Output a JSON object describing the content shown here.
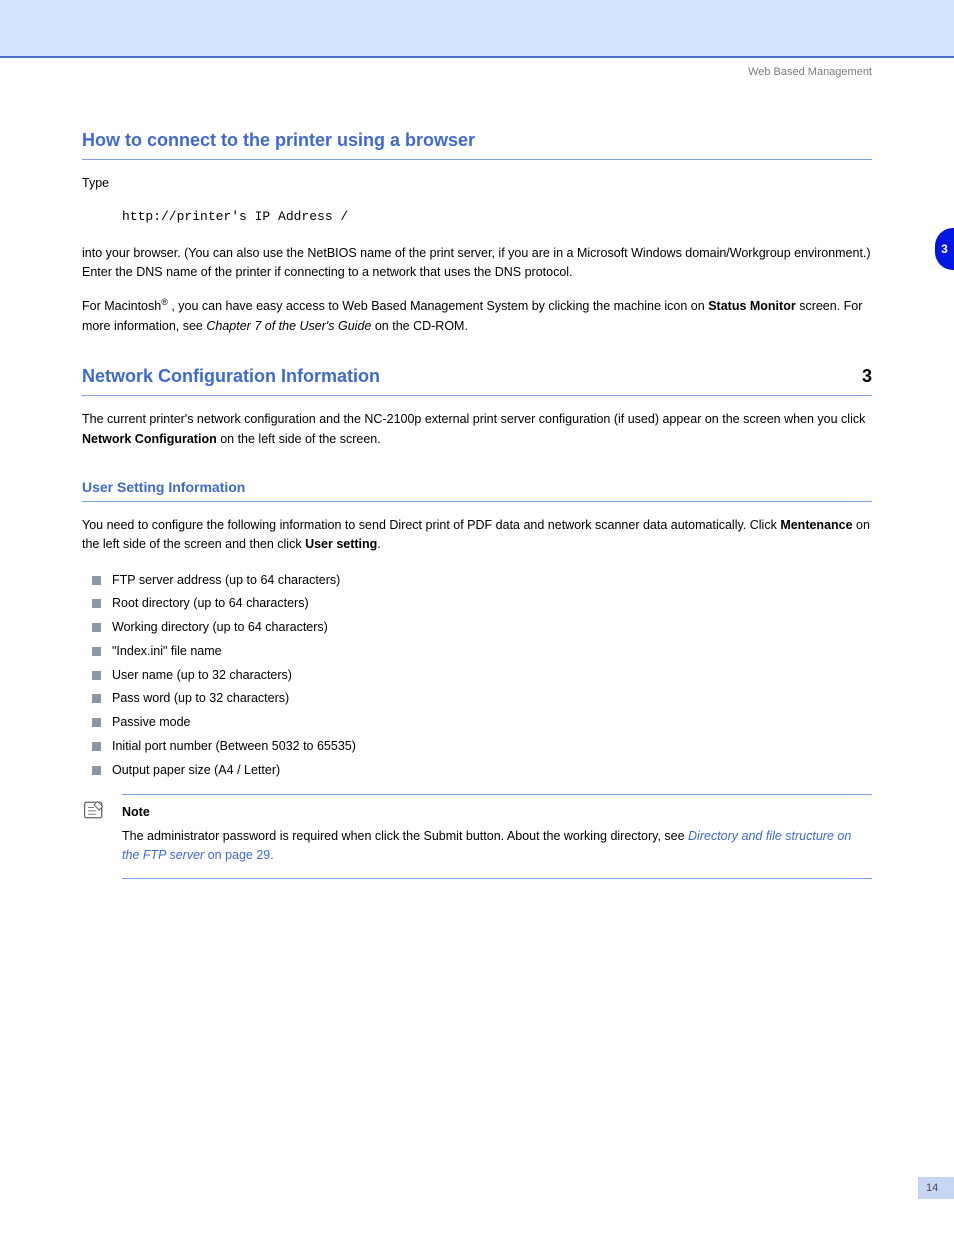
{
  "breadcrumb": "Web Based Management",
  "tab": "3",
  "section1": {
    "title": "How to connect to the printer using a browser",
    "para1": "Type",
    "code": "http://printer's IP Address /",
    "para1b": "into your browser. (You can also use the NetBIOS name of the print server, if you are in a Microsoft Windows domain/Workgroup environment.) Enter the DNS name of the printer if connecting to a network that uses the DNS protocol.",
    "para2": "For Macintosh",
    "para2b": ", you can have easy access to Web Based Management System by clicking the machine icon on",
    "para2c": "Status Monitor",
    "para2d": "screen. For more information, see",
    "para2e": "Chapter 7 of the User's Guide",
    "para2f": "on the CD-ROM."
  },
  "section2": {
    "title": "Network Configuration Information",
    "sub_num": "3",
    "para": "The current printer's network configuration and the NC-2100p external print server configuration (if used) appear on the screen when you click",
    "para_bold": "Network Configuration",
    "para2": "on the left side of the screen."
  },
  "section3": {
    "title": "User Setting Information",
    "para": "You need to configure the following information to send Direct print of PDF data and network scanner data automatically. Click",
    "para_bold": "Mentenance",
    "para2": "on the left side of the screen and then click",
    "para_bold2": "User setting",
    "para3": ".",
    "items": [
      "FTP server address (up to 64 characters)",
      "Root directory (up to 64 characters)",
      "Working directory (up to 64 characters)",
      "\"Index.ini\" file name",
      "User name (up to 32 characters)",
      "Pass word (up to 32 characters)",
      "Passive mode",
      "Initial port number (Between 5032 to 65535)",
      "Output paper size (A4 / Letter)"
    ],
    "note_label": "Note",
    "note_body": "The administrator password is required when click the Submit button. About the working directory, see",
    "note_link": "Directory and file structure on the FTP server",
    "note_page": "on page 29."
  },
  "footer_page": "14"
}
